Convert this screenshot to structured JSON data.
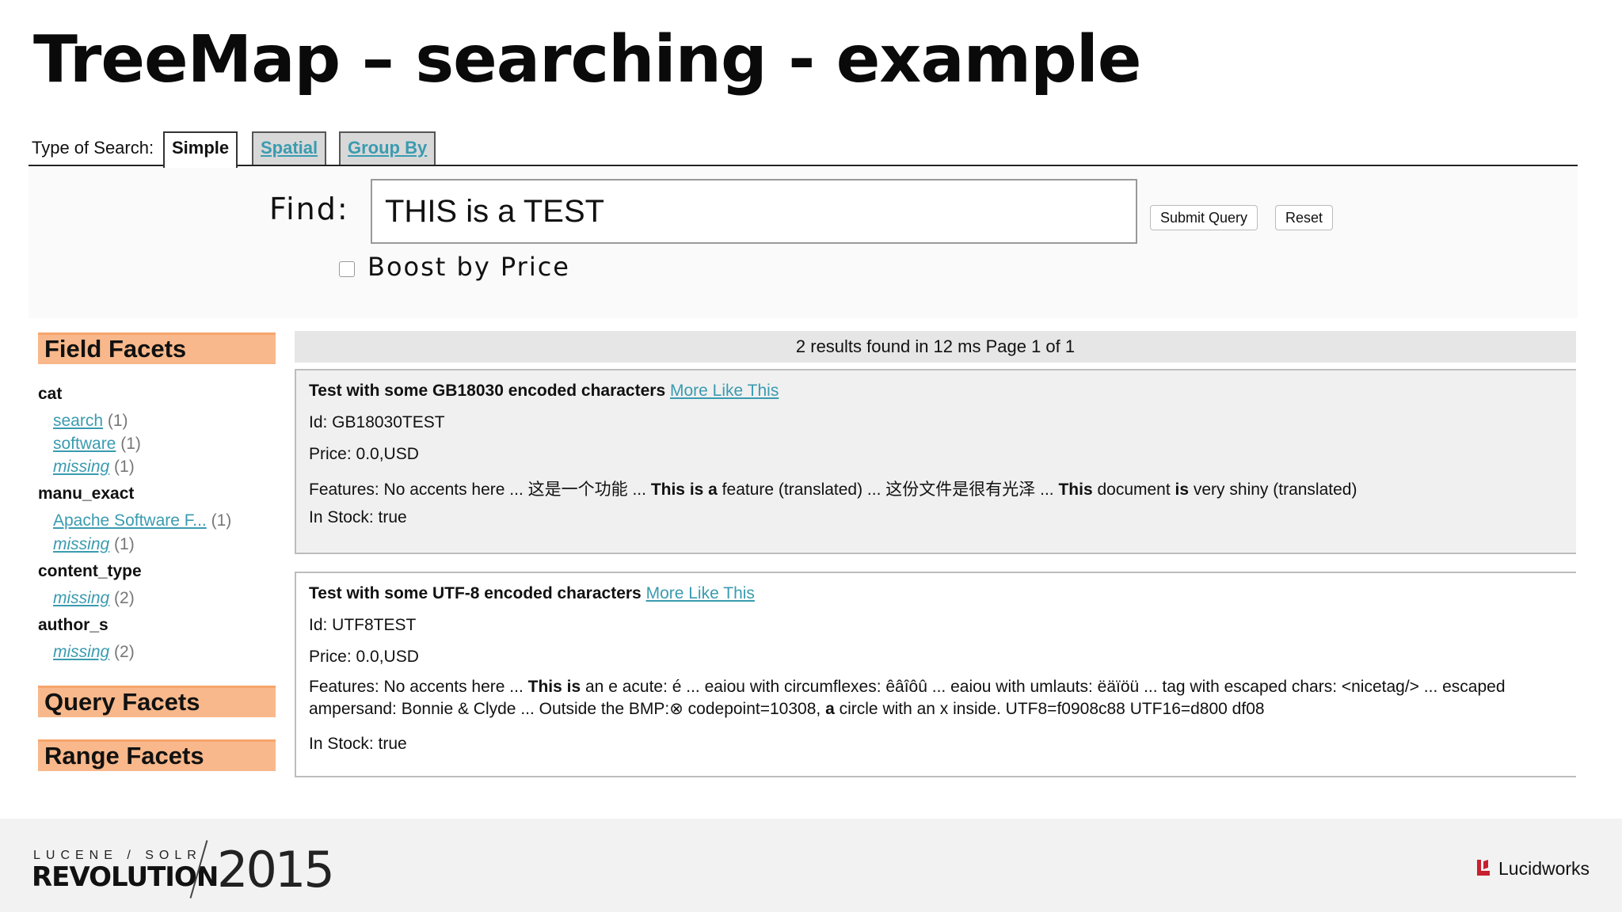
{
  "slide": {
    "title": "TreeMap – searching - example"
  },
  "tabs": {
    "label": "Type of Search:",
    "items": [
      {
        "label": "Simple",
        "active": true
      },
      {
        "label": "Spatial",
        "active": false
      },
      {
        "label": "Group By",
        "active": false
      }
    ]
  },
  "search": {
    "find_label": "Find:",
    "query_value": "THIS is a TEST",
    "submit_label": "Submit Query",
    "reset_label": "Reset",
    "boost_label": "Boost by Price",
    "boost_checked": false
  },
  "sidebar": {
    "field_facets_title": "Field Facets",
    "fields": [
      {
        "name": "cat",
        "items": [
          {
            "label": "search",
            "count": "(1)",
            "italic": false
          },
          {
            "label": "software",
            "count": "(1)",
            "italic": false
          },
          {
            "label": "missing",
            "count": "(1)",
            "italic": true
          }
        ]
      },
      {
        "name": "manu_exact",
        "items": [
          {
            "label": "Apache Software F...",
            "count": "(1)",
            "italic": false
          },
          {
            "label": "missing",
            "count": "(1)",
            "italic": true
          }
        ]
      },
      {
        "name": "content_type",
        "items": [
          {
            "label": "missing",
            "count": "(2)",
            "italic": true
          }
        ]
      },
      {
        "name": "author_s",
        "items": [
          {
            "label": "missing",
            "count": "(2)",
            "italic": true
          }
        ]
      }
    ],
    "query_facets_title": "Query Facets",
    "range_facets_title": "Range Facets"
  },
  "results": {
    "summary": "2 results found in 12 ms Page 1 of 1",
    "more_like_this": "More Like This",
    "items": [
      {
        "title": "Test with some GB18030 encoded characters",
        "id": "Id: GB18030TEST",
        "price": "Price: 0.0,USD",
        "features": {
          "prefix": "Features: No accents here ... 这是一个功能 ... ",
          "b1": "This is a",
          "t1": " feature (translated) ... 这份文件是很有光泽 ... ",
          "b2": "This",
          "t2": " document ",
          "b3": "is",
          "t3": " very shiny (translated)"
        },
        "stock": "In Stock: true"
      },
      {
        "title": "Test with some UTF-8 encoded characters",
        "id": "Id: UTF8TEST",
        "price": "Price: 0.0,USD",
        "features": {
          "prefix": "Features: No accents here ... ",
          "b1": "This is",
          "t1": " an e acute: é ... eaiou with circumflexes: êâîôû ... eaiou with umlauts: ëäïöü ... tag with escaped chars: <nicetag/> ... escaped ampersand: Bonnie & Clyde ... Outside the BMP:⊗ codepoint=10308, ",
          "b2": "a",
          "t2": " circle with an x inside. UTF8=f0908c88 UTF16=d800 df08"
        },
        "stock": "In Stock: true"
      }
    ]
  },
  "footer": {
    "lucene_solr": "LUCENE / SOLR",
    "revolution": "REVOLUTION",
    "year": "2015",
    "brand": "Lucidworks",
    "brand_color": "#c8202f"
  }
}
